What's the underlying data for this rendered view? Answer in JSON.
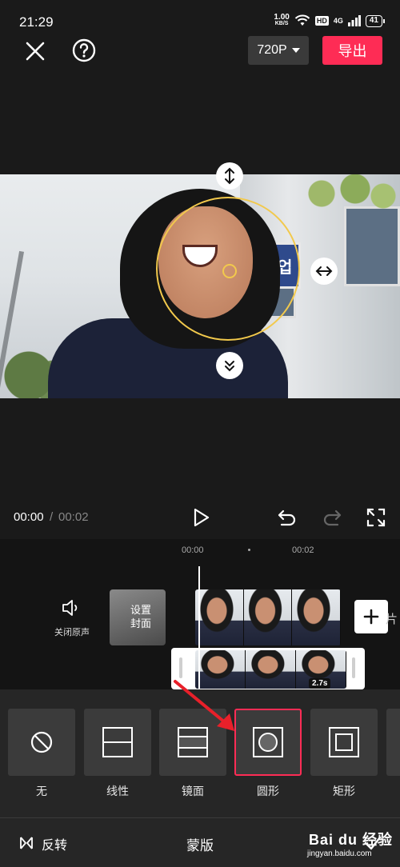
{
  "status_bar": {
    "time": "21:29",
    "net_speed_value": "1.00",
    "net_speed_unit": "KB/S",
    "hd_badge": "HD",
    "signal_label": "4G",
    "battery": "41"
  },
  "header": {
    "resolution": "720P",
    "export_label": "导出"
  },
  "preview": {
    "sign_text": "실업"
  },
  "playback": {
    "current_time": "00:00",
    "separator": "/",
    "total_time": "00:02"
  },
  "timeline": {
    "ruler": [
      "00:00",
      "00:02"
    ],
    "mute_label": "关闭原声",
    "cover_label": "设置\n封面",
    "clip_duration": "2.7s",
    "add_tail": "片"
  },
  "mask_options": [
    {
      "label": "无",
      "icon": "none-icon"
    },
    {
      "label": "线性",
      "icon": "linear-icon"
    },
    {
      "label": "镜面",
      "icon": "mirror-icon"
    },
    {
      "label": "圆形",
      "icon": "circle-icon",
      "selected": true
    },
    {
      "label": "矩形",
      "icon": "rectangle-icon"
    }
  ],
  "bottom_bar": {
    "invert_label": "反转",
    "title": "蒙版"
  },
  "watermark": {
    "brand": "Bai du 经验",
    "url": "jingyan.baidu.com"
  },
  "colors": {
    "accent": "#fe2c55",
    "mask_outline": "#f2c94c",
    "background": "#1a1a1a"
  }
}
